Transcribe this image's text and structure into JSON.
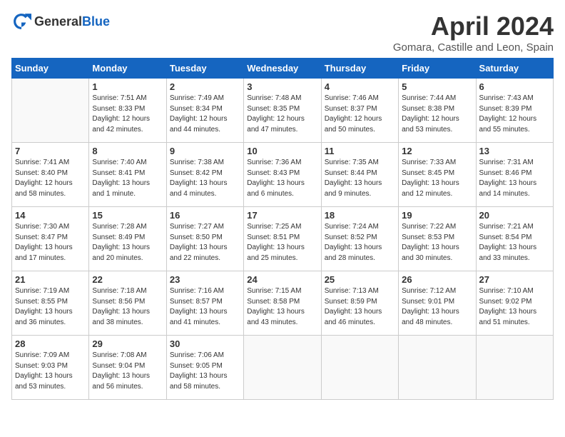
{
  "header": {
    "logo_general": "General",
    "logo_blue": "Blue",
    "month_title": "April 2024",
    "location": "Gomara, Castille and Leon, Spain"
  },
  "weekdays": [
    "Sunday",
    "Monday",
    "Tuesday",
    "Wednesday",
    "Thursday",
    "Friday",
    "Saturday"
  ],
  "weeks": [
    [
      {
        "day": "",
        "sunrise": "",
        "sunset": "",
        "daylight": ""
      },
      {
        "day": "1",
        "sunrise": "Sunrise: 7:51 AM",
        "sunset": "Sunset: 8:33 PM",
        "daylight": "Daylight: 12 hours and 42 minutes."
      },
      {
        "day": "2",
        "sunrise": "Sunrise: 7:49 AM",
        "sunset": "Sunset: 8:34 PM",
        "daylight": "Daylight: 12 hours and 44 minutes."
      },
      {
        "day": "3",
        "sunrise": "Sunrise: 7:48 AM",
        "sunset": "Sunset: 8:35 PM",
        "daylight": "Daylight: 12 hours and 47 minutes."
      },
      {
        "day": "4",
        "sunrise": "Sunrise: 7:46 AM",
        "sunset": "Sunset: 8:37 PM",
        "daylight": "Daylight: 12 hours and 50 minutes."
      },
      {
        "day": "5",
        "sunrise": "Sunrise: 7:44 AM",
        "sunset": "Sunset: 8:38 PM",
        "daylight": "Daylight: 12 hours and 53 minutes."
      },
      {
        "day": "6",
        "sunrise": "Sunrise: 7:43 AM",
        "sunset": "Sunset: 8:39 PM",
        "daylight": "Daylight: 12 hours and 55 minutes."
      }
    ],
    [
      {
        "day": "7",
        "sunrise": "Sunrise: 7:41 AM",
        "sunset": "Sunset: 8:40 PM",
        "daylight": "Daylight: 12 hours and 58 minutes."
      },
      {
        "day": "8",
        "sunrise": "Sunrise: 7:40 AM",
        "sunset": "Sunset: 8:41 PM",
        "daylight": "Daylight: 13 hours and 1 minute."
      },
      {
        "day": "9",
        "sunrise": "Sunrise: 7:38 AM",
        "sunset": "Sunset: 8:42 PM",
        "daylight": "Daylight: 13 hours and 4 minutes."
      },
      {
        "day": "10",
        "sunrise": "Sunrise: 7:36 AM",
        "sunset": "Sunset: 8:43 PM",
        "daylight": "Daylight: 13 hours and 6 minutes."
      },
      {
        "day": "11",
        "sunrise": "Sunrise: 7:35 AM",
        "sunset": "Sunset: 8:44 PM",
        "daylight": "Daylight: 13 hours and 9 minutes."
      },
      {
        "day": "12",
        "sunrise": "Sunrise: 7:33 AM",
        "sunset": "Sunset: 8:45 PM",
        "daylight": "Daylight: 13 hours and 12 minutes."
      },
      {
        "day": "13",
        "sunrise": "Sunrise: 7:31 AM",
        "sunset": "Sunset: 8:46 PM",
        "daylight": "Daylight: 13 hours and 14 minutes."
      }
    ],
    [
      {
        "day": "14",
        "sunrise": "Sunrise: 7:30 AM",
        "sunset": "Sunset: 8:47 PM",
        "daylight": "Daylight: 13 hours and 17 minutes."
      },
      {
        "day": "15",
        "sunrise": "Sunrise: 7:28 AM",
        "sunset": "Sunset: 8:49 PM",
        "daylight": "Daylight: 13 hours and 20 minutes."
      },
      {
        "day": "16",
        "sunrise": "Sunrise: 7:27 AM",
        "sunset": "Sunset: 8:50 PM",
        "daylight": "Daylight: 13 hours and 22 minutes."
      },
      {
        "day": "17",
        "sunrise": "Sunrise: 7:25 AM",
        "sunset": "Sunset: 8:51 PM",
        "daylight": "Daylight: 13 hours and 25 minutes."
      },
      {
        "day": "18",
        "sunrise": "Sunrise: 7:24 AM",
        "sunset": "Sunset: 8:52 PM",
        "daylight": "Daylight: 13 hours and 28 minutes."
      },
      {
        "day": "19",
        "sunrise": "Sunrise: 7:22 AM",
        "sunset": "Sunset: 8:53 PM",
        "daylight": "Daylight: 13 hours and 30 minutes."
      },
      {
        "day": "20",
        "sunrise": "Sunrise: 7:21 AM",
        "sunset": "Sunset: 8:54 PM",
        "daylight": "Daylight: 13 hours and 33 minutes."
      }
    ],
    [
      {
        "day": "21",
        "sunrise": "Sunrise: 7:19 AM",
        "sunset": "Sunset: 8:55 PM",
        "daylight": "Daylight: 13 hours and 36 minutes."
      },
      {
        "day": "22",
        "sunrise": "Sunrise: 7:18 AM",
        "sunset": "Sunset: 8:56 PM",
        "daylight": "Daylight: 13 hours and 38 minutes."
      },
      {
        "day": "23",
        "sunrise": "Sunrise: 7:16 AM",
        "sunset": "Sunset: 8:57 PM",
        "daylight": "Daylight: 13 hours and 41 minutes."
      },
      {
        "day": "24",
        "sunrise": "Sunrise: 7:15 AM",
        "sunset": "Sunset: 8:58 PM",
        "daylight": "Daylight: 13 hours and 43 minutes."
      },
      {
        "day": "25",
        "sunrise": "Sunrise: 7:13 AM",
        "sunset": "Sunset: 8:59 PM",
        "daylight": "Daylight: 13 hours and 46 minutes."
      },
      {
        "day": "26",
        "sunrise": "Sunrise: 7:12 AM",
        "sunset": "Sunset: 9:01 PM",
        "daylight": "Daylight: 13 hours and 48 minutes."
      },
      {
        "day": "27",
        "sunrise": "Sunrise: 7:10 AM",
        "sunset": "Sunset: 9:02 PM",
        "daylight": "Daylight: 13 hours and 51 minutes."
      }
    ],
    [
      {
        "day": "28",
        "sunrise": "Sunrise: 7:09 AM",
        "sunset": "Sunset: 9:03 PM",
        "daylight": "Daylight: 13 hours and 53 minutes."
      },
      {
        "day": "29",
        "sunrise": "Sunrise: 7:08 AM",
        "sunset": "Sunset: 9:04 PM",
        "daylight": "Daylight: 13 hours and 56 minutes."
      },
      {
        "day": "30",
        "sunrise": "Sunrise: 7:06 AM",
        "sunset": "Sunset: 9:05 PM",
        "daylight": "Daylight: 13 hours and 58 minutes."
      },
      {
        "day": "",
        "sunrise": "",
        "sunset": "",
        "daylight": ""
      },
      {
        "day": "",
        "sunrise": "",
        "sunset": "",
        "daylight": ""
      },
      {
        "day": "",
        "sunrise": "",
        "sunset": "",
        "daylight": ""
      },
      {
        "day": "",
        "sunrise": "",
        "sunset": "",
        "daylight": ""
      }
    ]
  ]
}
